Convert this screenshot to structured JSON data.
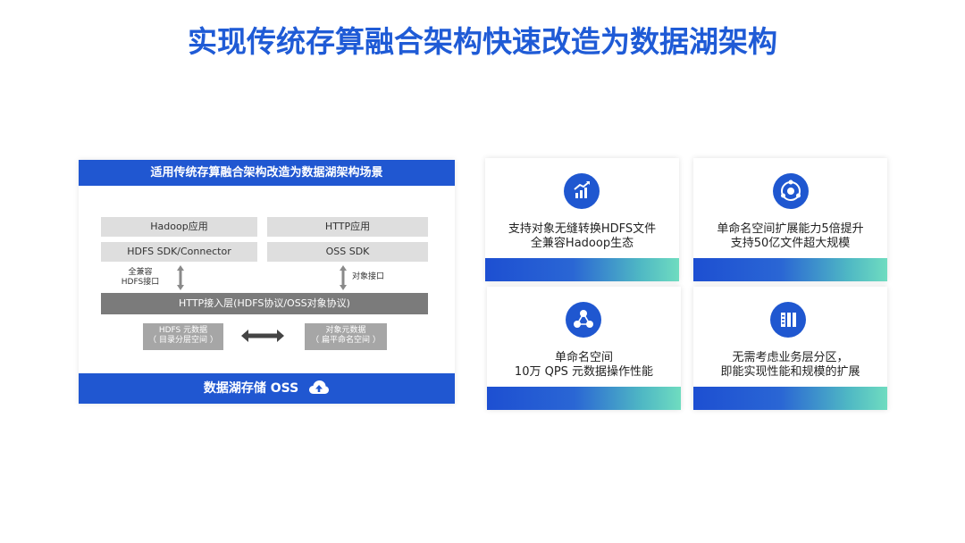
{
  "title": "实现传统存算融合架构快速改造为数据湖架构",
  "left_panel": {
    "header": "适用传统存算融合架构改造为数据湖架构场景",
    "hadoop_app": "Hadoop应用",
    "http_app": "HTTP应用",
    "hdfs_sdk": "HDFS SDK/Connector",
    "oss_sdk": "OSS SDK",
    "left_arrow_label_line1": "全兼容",
    "left_arrow_label_line2": "HDFS接口",
    "right_arrow_label": "对象接口",
    "http_layer": "HTTP接入层(HDFS协议/OSS对象协议)",
    "hdfs_meta_line1": "HDFS 元数据",
    "hdfs_meta_line2": "（ 目录分层空间 ）",
    "obj_meta_line1": "对象元数据",
    "obj_meta_line2": "（ 扁平命名空间 ）",
    "footer": "数据湖存储 OSS"
  },
  "cards": [
    {
      "line1": "支持对象无缝转换HDFS文件",
      "line2": "全兼容Hadoop生态",
      "icon": "chart-growth-icon"
    },
    {
      "line1": "单命名空间扩展能力5倍提升",
      "line2": "支持50亿文件超大规模",
      "icon": "orbit-icon"
    },
    {
      "line1": "单命名空间",
      "line2": "10万 QPS 元数据操作性能",
      "icon": "network-icon"
    },
    {
      "line1": "无需考虑业务层分区，",
      "line2": "即能实现性能和规模的扩展",
      "icon": "partition-icon"
    }
  ],
  "colors": {
    "primary_blue": "#2057d1",
    "title_blue": "#1f5bd6",
    "gray_box": "#dedede",
    "http_layer": "#7b7b7b",
    "meta_box": "#a6a6a6",
    "gradient_end": "#6fdcc0"
  }
}
